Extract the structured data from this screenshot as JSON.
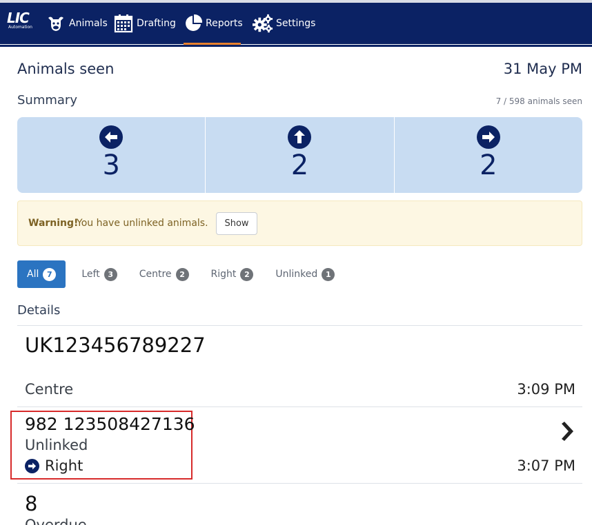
{
  "nav": {
    "brand": {
      "logo": "LIC",
      "sub": "Automation"
    },
    "items": [
      {
        "label": "Animals",
        "icon": "cow-icon"
      },
      {
        "label": "Drafting",
        "icon": "calendar-icon"
      },
      {
        "label": "Reports",
        "icon": "pie-chart-icon",
        "active": true
      },
      {
        "label": "Settings",
        "icon": "gears-icon"
      }
    ],
    "accent": "#e8812d",
    "background": "#0b2264"
  },
  "header": {
    "title": "Animals seen",
    "date": "31 May PM"
  },
  "summary": {
    "label": "Summary",
    "seen": "7 / 598 animals seen",
    "cells": [
      {
        "icon": "arrow-left-circle-icon",
        "count": "3"
      },
      {
        "icon": "arrow-up-circle-icon",
        "count": "2"
      },
      {
        "icon": "arrow-right-circle-icon",
        "count": "2"
      }
    ]
  },
  "warning": {
    "strong": "Warning!",
    "text": "You have unlinked animals.",
    "button": "Show"
  },
  "tabs": [
    {
      "label": "All",
      "count": "7",
      "active": true
    },
    {
      "label": "Left",
      "count": "3"
    },
    {
      "label": "Centre",
      "count": "2"
    },
    {
      "label": "Right",
      "count": "2"
    },
    {
      "label": "Unlinked",
      "count": "1"
    }
  ],
  "details": {
    "label": "Details",
    "rows": [
      {
        "id": "UK123456789227",
        "direction": "Centre",
        "time": "3:09 PM"
      },
      {
        "id": "982 123508427136",
        "status": "Unlinked",
        "direction": "Right",
        "time": "3:07 PM"
      },
      {
        "id": "8",
        "status": "Overdue"
      }
    ]
  }
}
